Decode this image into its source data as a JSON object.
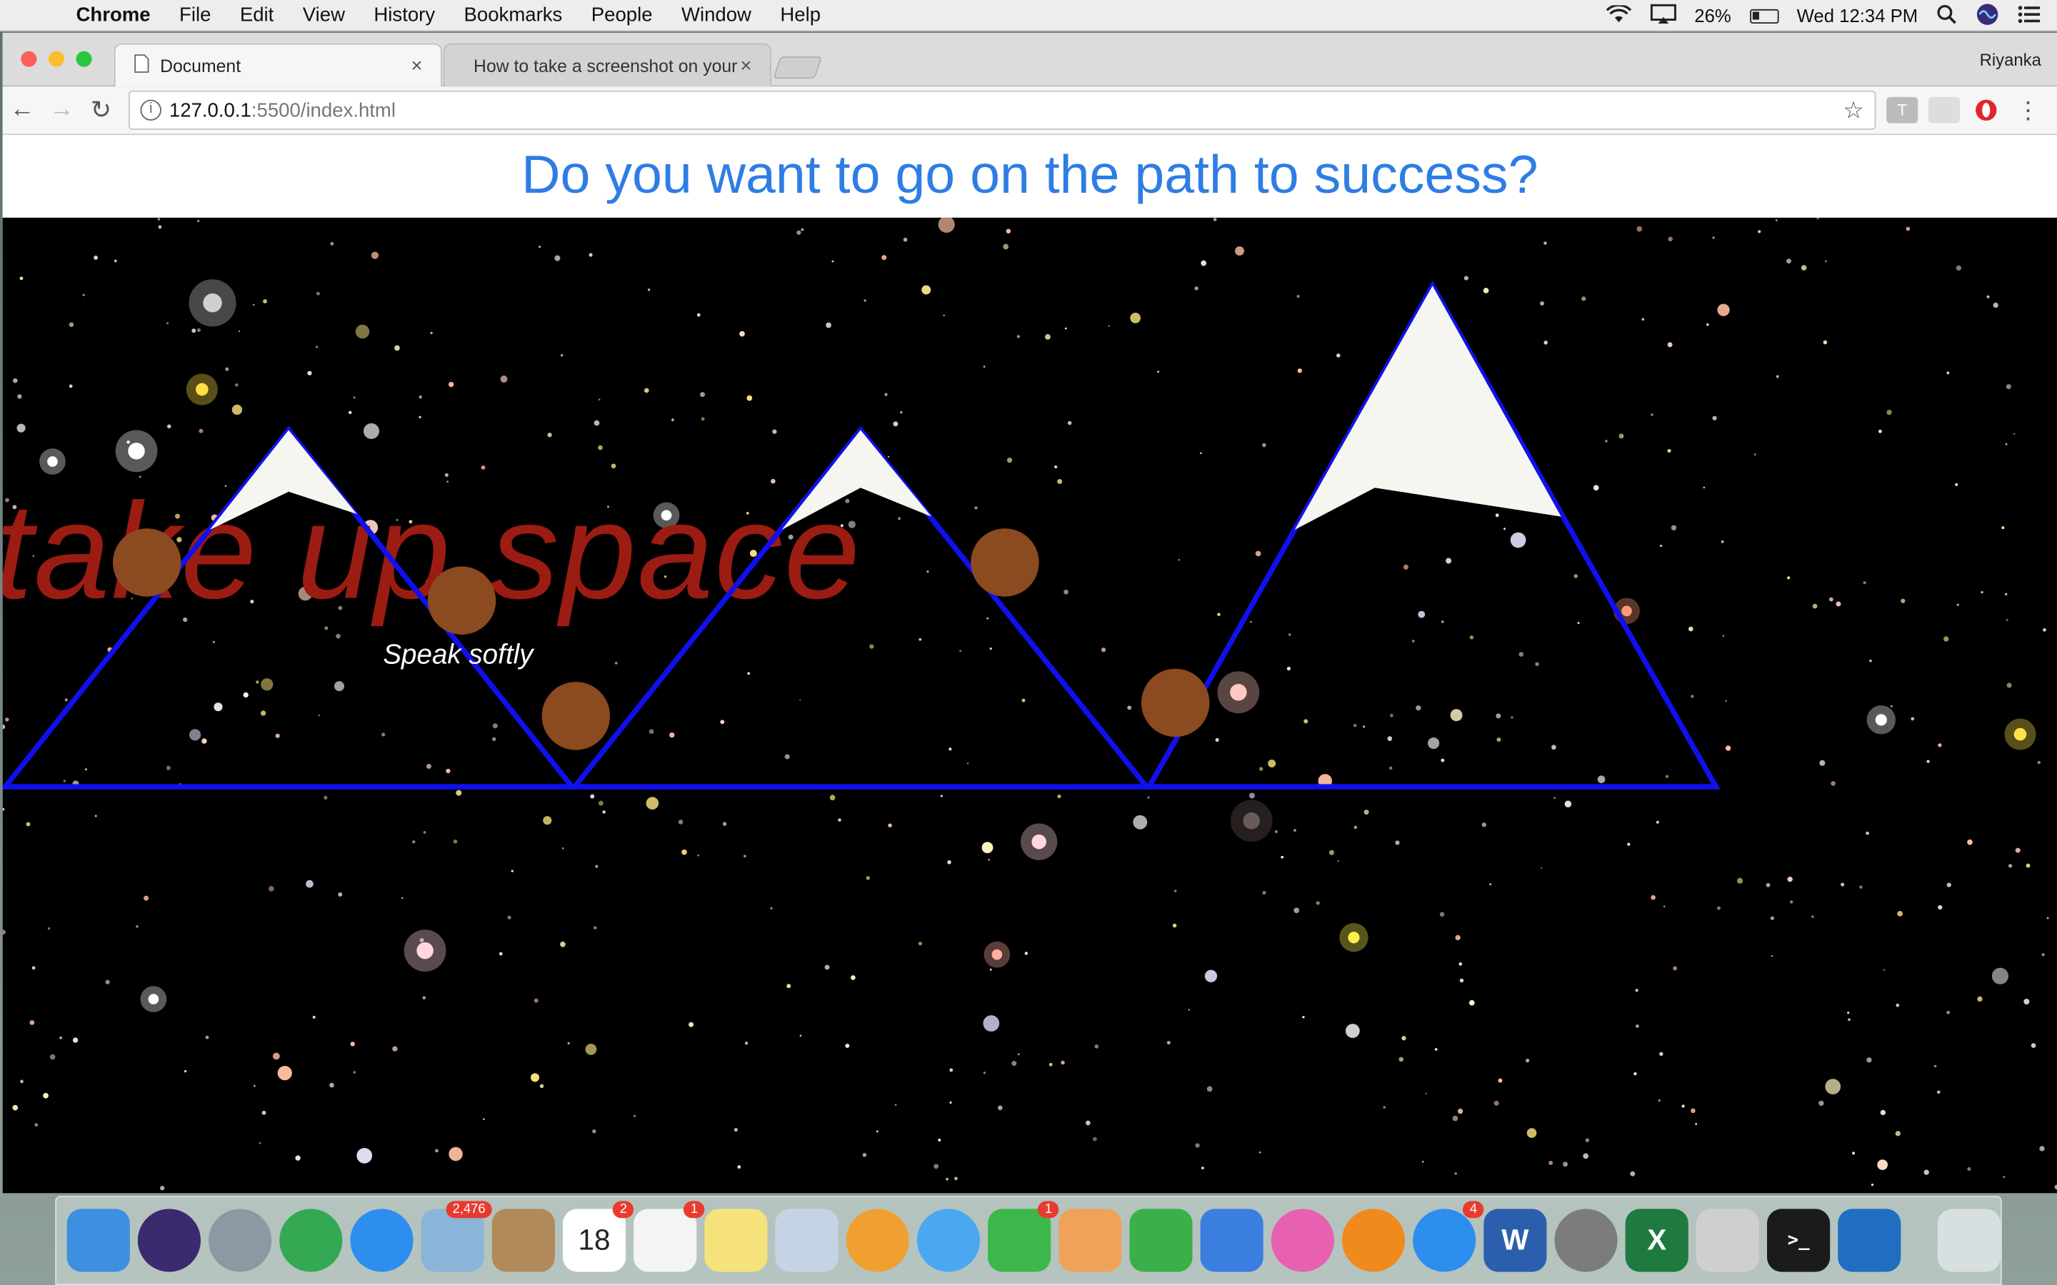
{
  "menubar": {
    "app": "Chrome",
    "items": [
      "File",
      "Edit",
      "View",
      "History",
      "Bookmarks",
      "People",
      "Window",
      "Help"
    ],
    "battery": "26%",
    "clock": "Wed 12:34 PM"
  },
  "browser": {
    "tabs": [
      {
        "title": "Document",
        "active": true
      },
      {
        "title": "How to take a screenshot on your Mac",
        "active": false
      }
    ],
    "profile": "Riyanka",
    "url_host": "127.0.0.1",
    "url_path": ":5500/index.html"
  },
  "page": {
    "heading": "Do you want to go on the path to success?",
    "big_text": "take up space",
    "small_text": "Speak softly"
  },
  "colors": {
    "heading": "#2e7de4",
    "mountain_outline": "#1010ee",
    "snow": "#f6f6f0",
    "ball": "#8b4a1f",
    "big_text": "#9b1c12",
    "background": "#000000"
  },
  "dock": {
    "icons": [
      {
        "name": "finder-icon",
        "color": "#3d8fe0"
      },
      {
        "name": "siri-icon",
        "color": "#3a2a6e"
      },
      {
        "name": "launchpad-icon",
        "color": "#8e98a4"
      },
      {
        "name": "chrome-icon",
        "color": "#34a853"
      },
      {
        "name": "safari-icon",
        "color": "#2d8ef0"
      },
      {
        "name": "mail-icon",
        "color": "#8ab5d8",
        "badge": "2,476"
      },
      {
        "name": "contacts-icon",
        "color": "#b08a5a"
      },
      {
        "name": "calendar-icon",
        "color": "#ffffff",
        "badge": "2",
        "label": "18"
      },
      {
        "name": "reminders-icon",
        "color": "#f4f4f4",
        "badge": "1"
      },
      {
        "name": "notes-icon",
        "color": "#f6e27a"
      },
      {
        "name": "preview-icon",
        "color": "#c5d4e4"
      },
      {
        "name": "photos-icon",
        "color": "#f0a030"
      },
      {
        "name": "messages-icon",
        "color": "#4aa8f0"
      },
      {
        "name": "facetime-icon",
        "color": "#3cb84a",
        "badge": "1"
      },
      {
        "name": "pages-icon",
        "color": "#f0a25a"
      },
      {
        "name": "numbers-icon",
        "color": "#3bb04a"
      },
      {
        "name": "keynote-icon",
        "color": "#3a7ee0"
      },
      {
        "name": "itunes-icon",
        "color": "#e860b0"
      },
      {
        "name": "ibooks-icon",
        "color": "#f08a1c"
      },
      {
        "name": "app-store-icon",
        "color": "#2d8ef0",
        "badge": "4"
      },
      {
        "name": "word-icon",
        "color": "#2b5fae",
        "label": "W"
      },
      {
        "name": "system-preferences-icon",
        "color": "#7c7c7c"
      },
      {
        "name": "excel-icon",
        "color": "#1e7a3e",
        "label": "X"
      },
      {
        "name": "printer-icon",
        "color": "#cfcfcf"
      },
      {
        "name": "terminal-icon",
        "color": "#1b1b1b",
        "label": ">_"
      },
      {
        "name": "vscode-icon",
        "color": "#1f6ec2"
      },
      {
        "name": "trash-icon",
        "color": "#d8dfe0"
      }
    ]
  }
}
